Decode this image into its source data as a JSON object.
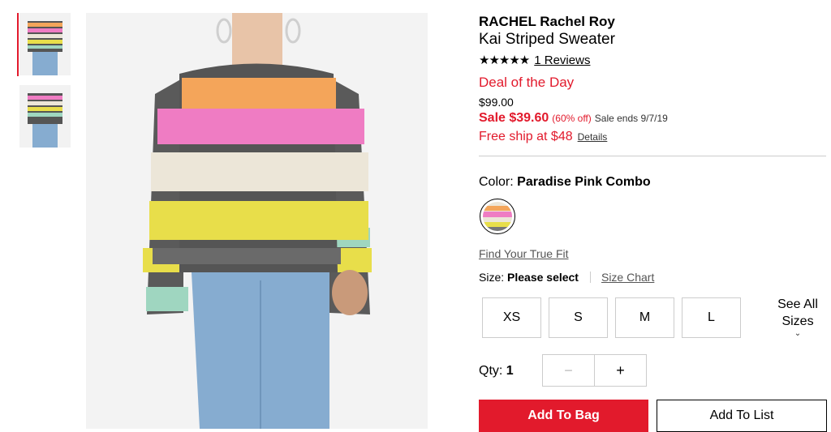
{
  "thumbnails": [
    {
      "name": "front-view",
      "active": true
    },
    {
      "name": "alt-view",
      "active": false
    }
  ],
  "product": {
    "brand": "RACHEL Rachel Roy",
    "title": "Kai Striped Sweater",
    "stars": "★★★★★",
    "reviews_label": "1 Reviews",
    "deal_label": "Deal of the Day",
    "original_price": "$99.00",
    "sale_price": "Sale $39.60",
    "sale_off": "(60% off)",
    "sale_ends": "Sale ends 9/7/19",
    "shipping": "Free ship at $48",
    "shipping_details": "Details"
  },
  "color": {
    "label": "Color:",
    "value": "Paradise Pink Combo"
  },
  "fit": {
    "truefit_label": "Find Your True Fit"
  },
  "size": {
    "label": "Size:",
    "value": "Please select",
    "chart_label": "Size Chart",
    "options": [
      "XS",
      "S",
      "M",
      "L"
    ],
    "see_all_line1": "See All",
    "see_all_line2": "Sizes",
    "see_all_chevron": "⌄"
  },
  "quantity": {
    "label": "Qty:",
    "value": "1",
    "minus": "−",
    "plus": "+"
  },
  "actions": {
    "add_to_bag": "Add To Bag",
    "add_to_list": "Add To List"
  },
  "colors": {
    "accent": "#e21a2c"
  }
}
